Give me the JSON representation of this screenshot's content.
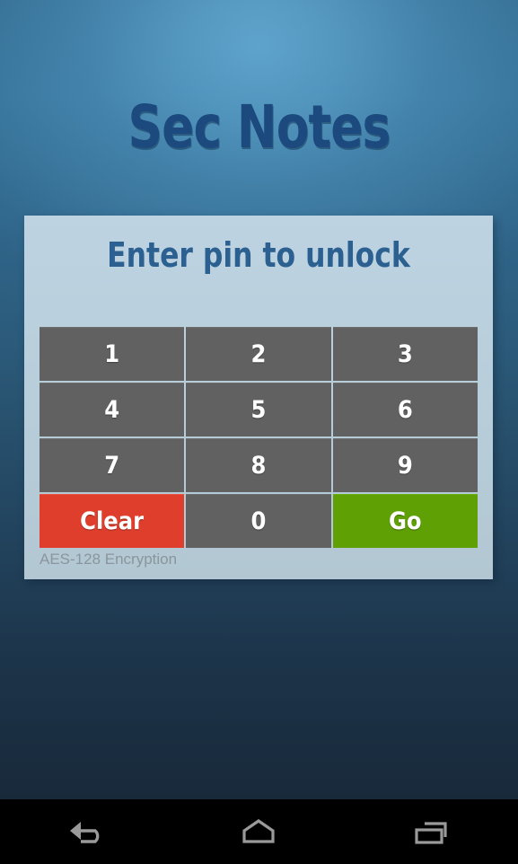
{
  "app": {
    "title": "Sec Notes"
  },
  "lock_card": {
    "heading": "Enter pin to unlock",
    "footer_note": "AES-128 Encryption",
    "keypad": {
      "rows": [
        [
          {
            "label": "1",
            "kind": "digit"
          },
          {
            "label": "2",
            "kind": "digit"
          },
          {
            "label": "3",
            "kind": "digit"
          }
        ],
        [
          {
            "label": "4",
            "kind": "digit"
          },
          {
            "label": "5",
            "kind": "digit"
          },
          {
            "label": "6",
            "kind": "digit"
          }
        ],
        [
          {
            "label": "7",
            "kind": "digit"
          },
          {
            "label": "8",
            "kind": "digit"
          },
          {
            "label": "9",
            "kind": "digit"
          }
        ],
        [
          {
            "label": "Clear",
            "kind": "clear"
          },
          {
            "label": "0",
            "kind": "digit"
          },
          {
            "label": "Go",
            "kind": "go"
          }
        ]
      ]
    }
  },
  "navbar": {
    "buttons": [
      {
        "name": "back-icon",
        "label": "Back"
      },
      {
        "name": "home-icon",
        "label": "Home"
      },
      {
        "name": "recents-icon",
        "label": "Recent apps"
      }
    ]
  },
  "colors": {
    "key_digit": "#616161",
    "key_clear": "#e03e2d",
    "key_go": "#5fa005",
    "card_bg": "#b8cfdf",
    "title_blue": "#1d4a7e",
    "heading_blue": "#2b6090",
    "footer_gray": "#8b959d",
    "navbar_bg": "#000000",
    "nav_icon": "#9a9a9a"
  }
}
